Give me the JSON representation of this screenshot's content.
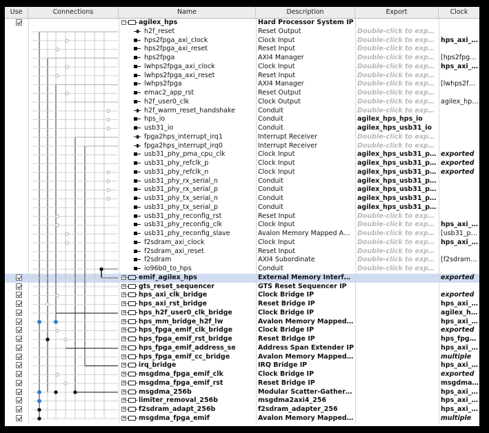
{
  "header": {
    "use": "Use",
    "connections": "Connections",
    "name": "Name",
    "description": "Description",
    "export": "Export",
    "clock": "Clock"
  },
  "rows": [
    {
      "use": "checked",
      "name": "agilex_hps",
      "level": 0,
      "kind": "component",
      "expand": "minus",
      "desc": "Hard Processor System IP",
      "desc_bold": true,
      "export": "",
      "clock": ""
    },
    {
      "use": "",
      "name": "h2f_reset",
      "level": 1,
      "kind": "top",
      "desc": "Reset Output",
      "export": "Double-click to export",
      "clock": ""
    },
    {
      "use": "",
      "name": "hps2fpga_axi_clock",
      "level": 1,
      "kind": "port",
      "desc": "Clock Input",
      "export": "Double-click to export",
      "clock": "hps_axi_cl..."
    },
    {
      "use": "",
      "name": "hps2fpga_axi_reset",
      "level": 1,
      "kind": "port",
      "desc": "Reset Input",
      "export": "Double-click to export",
      "clock": ""
    },
    {
      "use": "",
      "name": "hps2fpga",
      "level": 1,
      "kind": "port",
      "desc": "AXI4 Manager",
      "export": "Double-click to export",
      "clock": "[hps2fpga_..."
    },
    {
      "use": "",
      "name": "lwhps2fpga_axi_clock",
      "level": 1,
      "kind": "port",
      "desc": "Clock Input",
      "export": "Double-click to export",
      "clock": "hps_axi_cl..."
    },
    {
      "use": "",
      "name": "lwhps2fpga_axi_reset",
      "level": 1,
      "kind": "port",
      "desc": "Reset Input",
      "export": "Double-click to export",
      "clock": ""
    },
    {
      "use": "",
      "name": "lwhps2fpga",
      "level": 1,
      "kind": "port",
      "desc": "AXI4 Manager",
      "export": "Double-click to export",
      "clock": "[lwhps2fpg..."
    },
    {
      "use": "",
      "name": "emac2_app_rst",
      "level": 1,
      "kind": "port",
      "desc": "Reset Output",
      "export": "Double-click to export",
      "clock": ""
    },
    {
      "use": "",
      "name": "h2f_user0_clk",
      "level": 1,
      "kind": "port",
      "desc": "Clock Output",
      "export": "Double-click to export",
      "clock": "agilex_hps_..."
    },
    {
      "use": "",
      "name": "h2f_warm_reset_handshake",
      "level": 1,
      "kind": "top",
      "desc": "Conduit",
      "export": "Double-click to export",
      "clock": ""
    },
    {
      "use": "",
      "name": "hps_io",
      "level": 1,
      "kind": "port",
      "desc": "Conduit",
      "export": "agilex_hps_hps_io",
      "export_bold": true,
      "clock": ""
    },
    {
      "use": "",
      "name": "usb31_io",
      "level": 1,
      "kind": "port",
      "desc": "Conduit",
      "export": "agilex_hps_usb31_io",
      "export_bold": true,
      "clock": ""
    },
    {
      "use": "",
      "name": "fpga2hps_interrupt_irq1",
      "level": 1,
      "kind": "top",
      "desc": "Interrupt Receiver",
      "export": "Double-click to export",
      "clock": ""
    },
    {
      "use": "",
      "name": "fpga2hps_interrupt_irq0",
      "level": 1,
      "kind": "top",
      "desc": "Interrupt Receiver",
      "export": "Double-click to export",
      "clock": ""
    },
    {
      "use": "",
      "name": "usb31_phy_pma_cpu_clk",
      "level": 1,
      "kind": "port",
      "desc": "Clock Input",
      "export": "agilex_hps_usb31_phy_p...",
      "export_bold": true,
      "clock": "exported",
      "clock_ital": true
    },
    {
      "use": "",
      "name": "usb31_phy_refclk_p",
      "level": 1,
      "kind": "port",
      "desc": "Clock Input",
      "export": "agilex_hps_usb31_phy_r...",
      "export_bold": true,
      "clock": "exported",
      "clock_ital": true
    },
    {
      "use": "",
      "name": "usb31_phy_refclk_n",
      "level": 1,
      "kind": "port",
      "desc": "Clock Input",
      "export": "agilex_hps_usb31_phy_r...",
      "export_bold": true,
      "clock": "exported",
      "clock_ital": true
    },
    {
      "use": "",
      "name": "usb31_phy_rx_serial_n",
      "level": 1,
      "kind": "port",
      "desc": "Conduit",
      "export": "agilex_hps_usb31_phy_r...",
      "export_bold": true,
      "clock": ""
    },
    {
      "use": "",
      "name": "usb31_phy_rx_serial_p",
      "level": 1,
      "kind": "port",
      "desc": "Conduit",
      "export": "agilex_hps_usb31_phy_r...",
      "export_bold": true,
      "clock": ""
    },
    {
      "use": "",
      "name": "usb31_phy_tx_serial_n",
      "level": 1,
      "kind": "port",
      "desc": "Conduit",
      "export": "agilex_hps_usb31_phy_t...",
      "export_bold": true,
      "clock": ""
    },
    {
      "use": "",
      "name": "usb31_phy_tx_serial_p",
      "level": 1,
      "kind": "port",
      "desc": "Conduit",
      "export": "agilex_hps_usb31_phy_t...",
      "export_bold": true,
      "clock": ""
    },
    {
      "use": "",
      "name": "usb31_phy_reconfig_rst",
      "level": 1,
      "kind": "port",
      "desc": "Reset Input",
      "export": "Double-click to export",
      "clock": ""
    },
    {
      "use": "",
      "name": "usb31_phy_reconfig_clk",
      "level": 1,
      "kind": "port",
      "desc": "Clock Input",
      "export": "Double-click to export",
      "clock": "hps_axi_cl..."
    },
    {
      "use": "",
      "name": "usb31_phy_reconfig_slave",
      "level": 1,
      "kind": "port",
      "desc": "Avalon Memory Mapped Agent",
      "export": "Double-click to export",
      "clock": "[usb31_phy..."
    },
    {
      "use": "",
      "name": "f2sdram_axi_clock",
      "level": 1,
      "kind": "port",
      "desc": "Clock Input",
      "export": "Double-click to export",
      "clock": "hps_axi_cl..."
    },
    {
      "use": "",
      "name": "f2sdram_axi_reset",
      "level": 1,
      "kind": "port",
      "desc": "Reset Input",
      "export": "Double-click to export",
      "clock": ""
    },
    {
      "use": "",
      "name": "f2sdram",
      "level": 1,
      "kind": "port",
      "desc": "AXI4 Subordinate",
      "export": "Double-click to export",
      "clock": "[f2sdram_a..."
    },
    {
      "use": "",
      "name": "io96b0_to_hps",
      "level": 1,
      "kind": "port",
      "desc": "Conduit",
      "export": "Double-click to export",
      "clock": ""
    },
    {
      "use": "checked",
      "name": "emif_agilex_hps",
      "level": 0,
      "kind": "component",
      "expand": "plus",
      "desc": "External Memory Interfaces f...",
      "desc_bold": true,
      "export": "",
      "clock": "exported",
      "clock_ital": true,
      "selected": true
    },
    {
      "use": "checked",
      "name": "gts_reset_sequencer",
      "level": 0,
      "kind": "component",
      "expand": "plus",
      "desc": "GTS Reset Sequencer IP",
      "desc_bold": true,
      "export": "",
      "clock": ""
    },
    {
      "use": "checked",
      "name": "hps_axi_clk_bridge",
      "level": 0,
      "kind": "component",
      "expand": "plus",
      "desc": "Clock Bridge IP",
      "desc_bold": true,
      "export": "",
      "clock": "exported",
      "clock_ital": true
    },
    {
      "use": "checked",
      "name": "hps_axi_rst_bridge",
      "level": 0,
      "kind": "component",
      "expand": "plus",
      "desc": "Reset Bridge IP",
      "desc_bold": true,
      "export": "",
      "clock": "hps_axi_cl...",
      "clock_bold": true
    },
    {
      "use": "checked",
      "name": "hps_h2f_user0_clk_bridge",
      "level": 0,
      "kind": "component",
      "expand": "plus",
      "desc": "Clock Bridge IP",
      "desc_bold": true,
      "export": "",
      "clock": "agilex_hps...",
      "clock_bold": true
    },
    {
      "use": "checked",
      "name": "hps_mm_bridge_h2f_lw",
      "level": 0,
      "kind": "component",
      "expand": "plus",
      "desc": "Avalon Memory Mapped Pipeli...",
      "desc_bold": true,
      "export": "",
      "clock": "hps_axi_cl...",
      "clock_bold": true
    },
    {
      "use": "checked",
      "name": "hps_fpga_emif_clk_bridge",
      "level": 0,
      "kind": "component",
      "expand": "plus",
      "desc": "Clock Bridge IP",
      "desc_bold": true,
      "export": "",
      "clock": "exported",
      "clock_ital": true
    },
    {
      "use": "checked",
      "name": "hps_fpga_emif_rst_bridge",
      "level": 0,
      "kind": "component",
      "expand": "plus",
      "desc": "Reset Bridge IP",
      "desc_bold": true,
      "export": "",
      "clock": "hps_fpga_...",
      "clock_bold": true
    },
    {
      "use": "checked",
      "name": "hps_fpga_emif_address_se",
      "level": 0,
      "kind": "component",
      "expand": "plus",
      "desc": "Address Span Extender IP",
      "desc_bold": true,
      "export": "",
      "clock": "hps_axi_cl...",
      "clock_bold": true
    },
    {
      "use": "checked",
      "name": "hps_fpga_emif_cc_bridge",
      "level": 0,
      "kind": "component",
      "expand": "plus",
      "desc": "Avalon Memory Mapped Clock...",
      "desc_bold": true,
      "export": "",
      "clock": "multiple",
      "clock_ital": true
    },
    {
      "use": "checked",
      "name": "irq_bridge",
      "level": 0,
      "kind": "component",
      "expand": "plus",
      "desc": "IRQ Bridge IP",
      "desc_bold": true,
      "export": "",
      "clock": "hps_axi_cl...",
      "clock_bold": true
    },
    {
      "use": "checked",
      "name": "msgdma_fpga_emif_clk",
      "level": 0,
      "kind": "component",
      "expand": "plus",
      "desc": "Clock Bridge IP",
      "desc_bold": true,
      "export": "",
      "clock": "exported",
      "clock_ital": true
    },
    {
      "use": "checked",
      "name": "msgdma_fpga_emif_rst",
      "level": 0,
      "kind": "component",
      "expand": "plus",
      "desc": "Reset Bridge IP",
      "desc_bold": true,
      "export": "",
      "clock": "msgdma_f...",
      "clock_bold": true
    },
    {
      "use": "checked",
      "name": "msgdma_256b",
      "level": 0,
      "kind": "component",
      "expand": "plus",
      "desc": "Modular Scatter-Gather DMA ...",
      "desc_bold": true,
      "export": "",
      "clock": "hps_axi_cl...",
      "clock_bold": true
    },
    {
      "use": "checked",
      "name": "limiter_removal_256b",
      "level": 0,
      "kind": "component",
      "expand": "plus",
      "desc": "msgdma2axi4_256",
      "desc_bold": true,
      "export": "",
      "clock": "hps_axi_cl...",
      "clock_bold": true
    },
    {
      "use": "checked",
      "name": "f2sdram_adapt_256b",
      "level": 0,
      "kind": "component",
      "expand": "plus",
      "desc": "f2sdram_adapter_256",
      "desc_bold": true,
      "export": "",
      "clock": "hps_axi_cl...",
      "clock_bold": true
    },
    {
      "use": "checked",
      "name": "msgdma_fpga_emif",
      "level": 0,
      "kind": "component",
      "expand": "plus",
      "desc": "Avalon Memory Mapped Clock...",
      "desc_bold": true,
      "export": "",
      "clock": "multiple",
      "clock_ital": true
    }
  ]
}
